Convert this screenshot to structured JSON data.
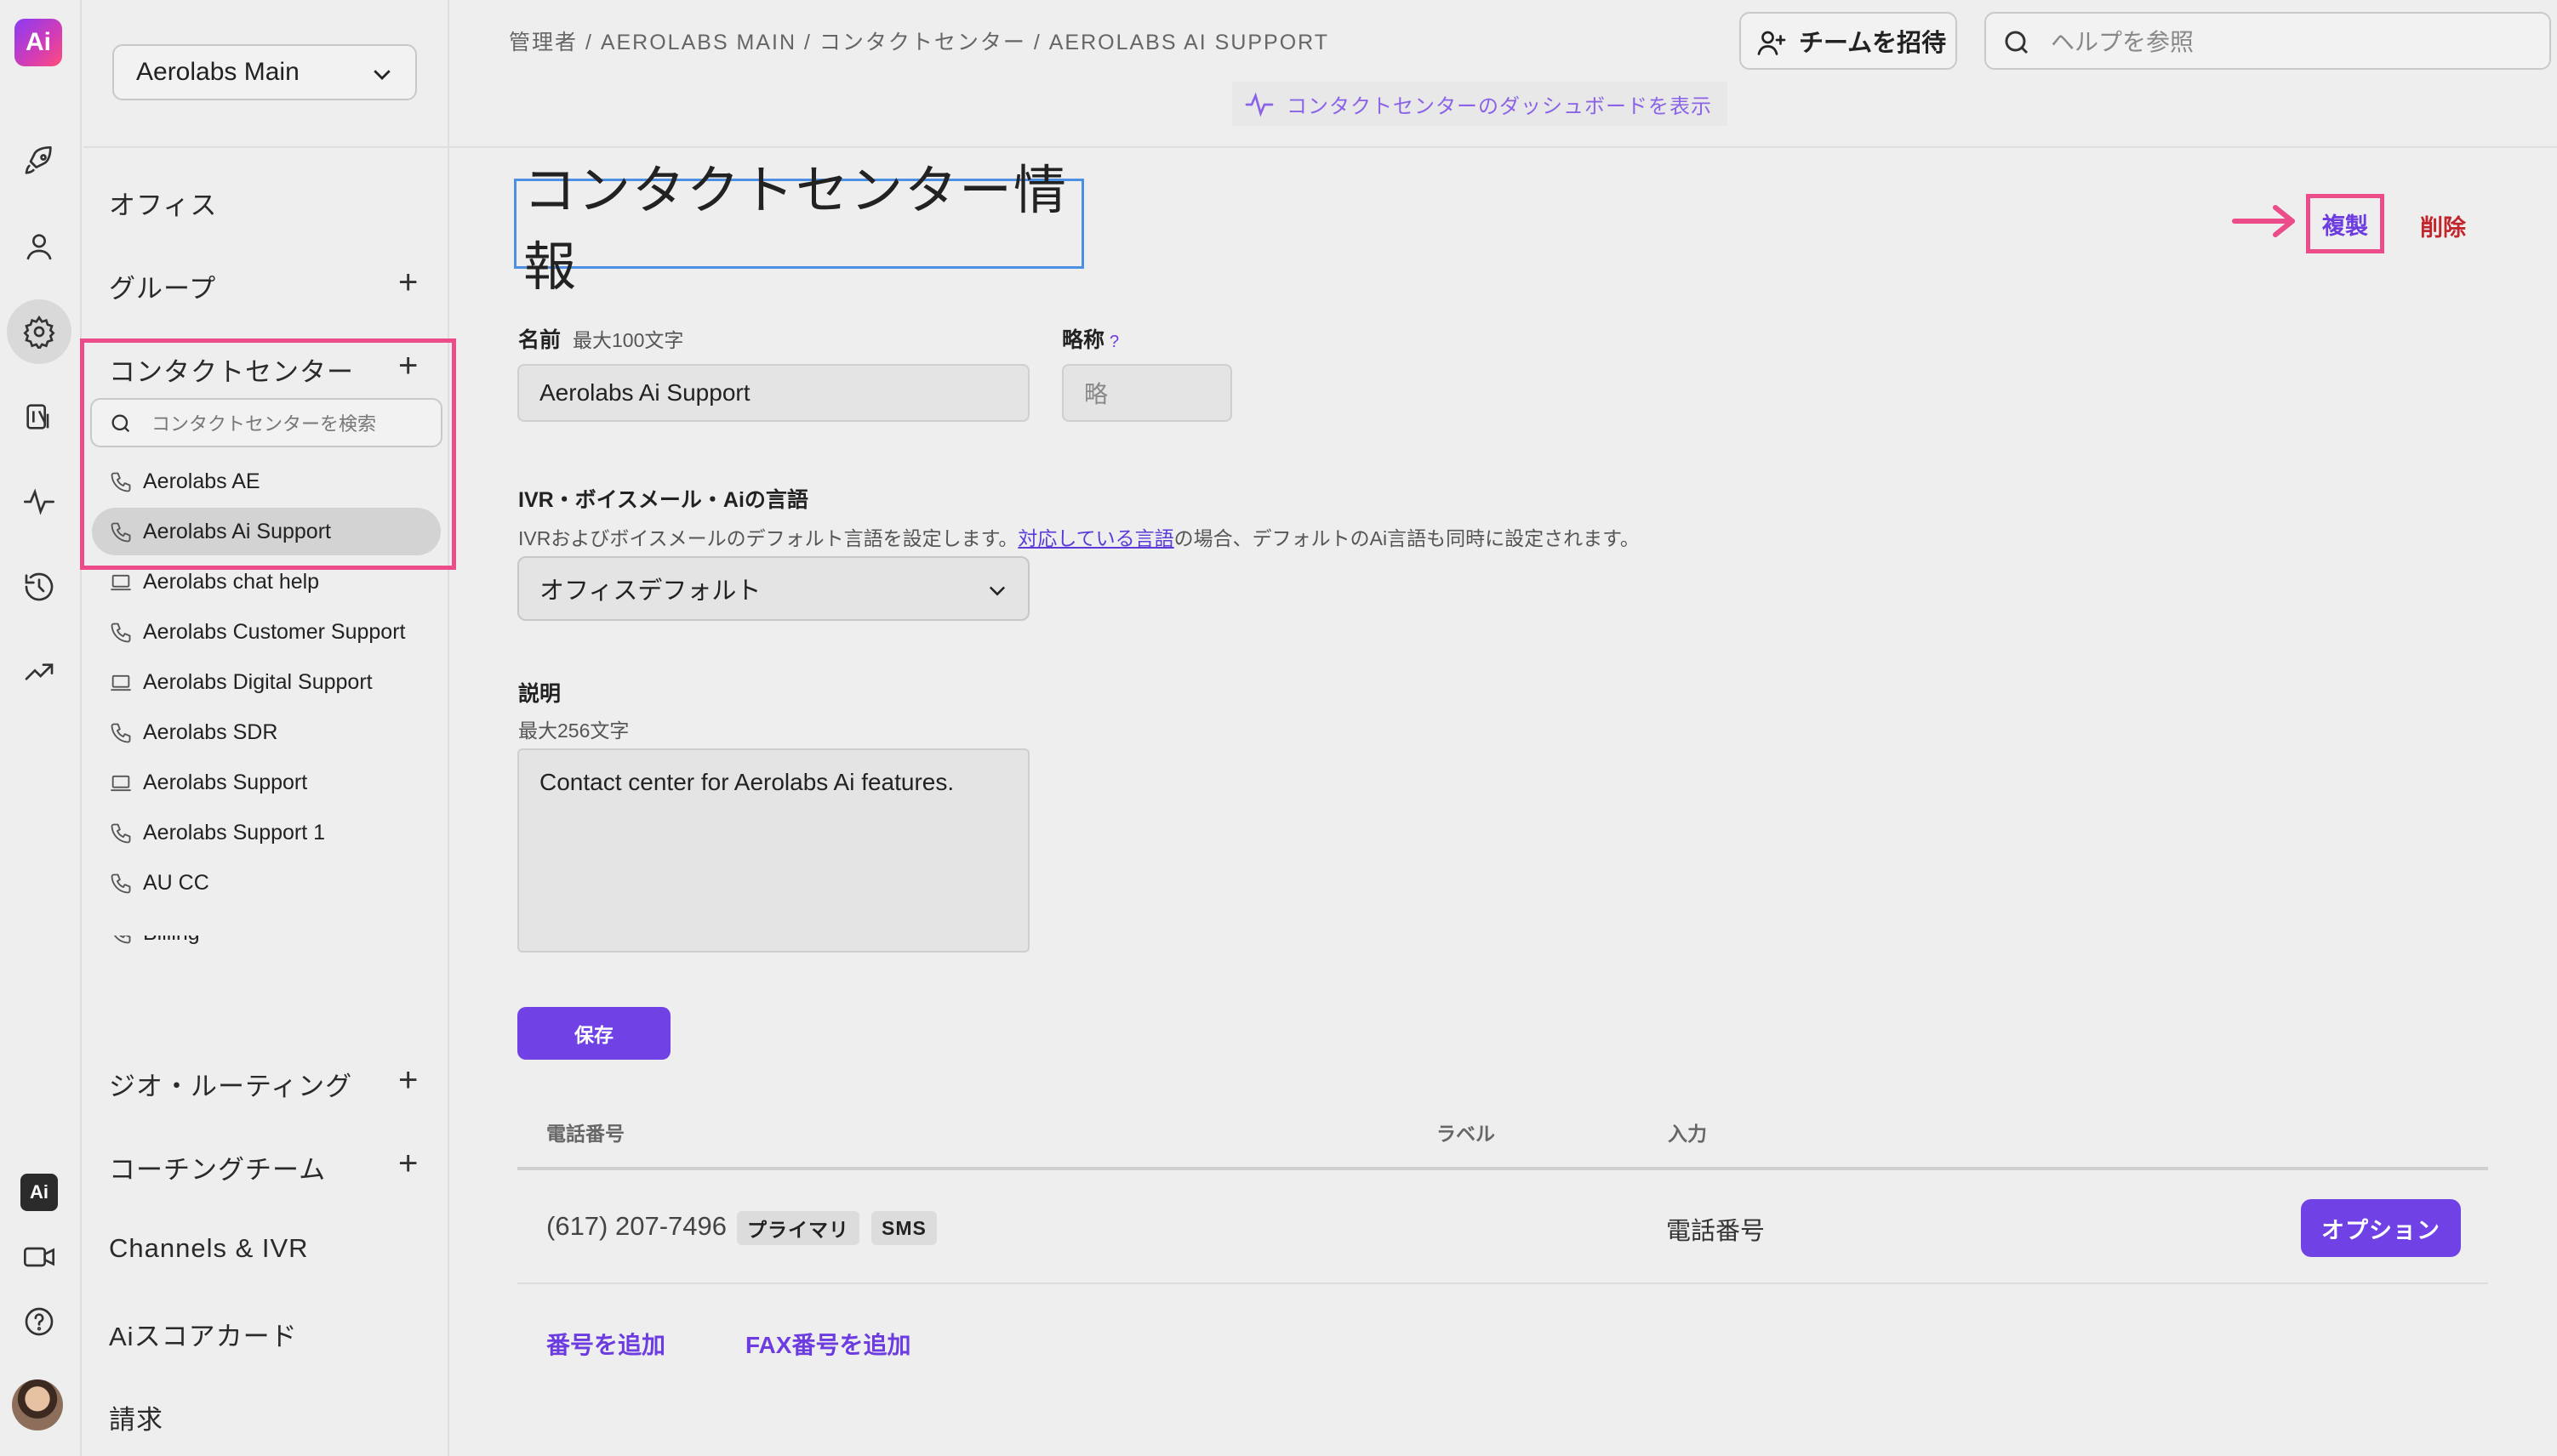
{
  "workspace": {
    "name": "Aerolabs Main"
  },
  "breadcrumb": "管理者 / AEROLABS MAIN / コンタクトセンター / AEROLABS AI SUPPORT",
  "header": {
    "invite_label": "チームを招待",
    "help_placeholder": "ヘルプを参照",
    "dashboard_link": "コンタクトセンターのダッシュボードを表示"
  },
  "sidebar": {
    "office": "オフィス",
    "groups": "グループ",
    "contact_center": "コンタクトセンター",
    "cc_search_placeholder": "コンタクトセンターを検索",
    "cc_items": [
      {
        "label": "Aerolabs AE",
        "icon": "phone-icon"
      },
      {
        "label": "Aerolabs Ai Support",
        "icon": "phone-icon"
      },
      {
        "label": "Aerolabs chat help",
        "icon": "laptop-icon"
      },
      {
        "label": "Aerolabs Customer Support",
        "icon": "phone-icon"
      },
      {
        "label": "Aerolabs Digital Support",
        "icon": "laptop-icon"
      },
      {
        "label": "Aerolabs SDR",
        "icon": "phone-icon"
      },
      {
        "label": "Aerolabs Support",
        "icon": "laptop-icon"
      },
      {
        "label": "Aerolabs Support 1",
        "icon": "phone-icon"
      },
      {
        "label": "AU CC",
        "icon": "phone-icon"
      },
      {
        "label": "Billing",
        "icon": "phone-icon"
      }
    ],
    "geo_routing": "ジオ・ルーティング",
    "coaching": "コーチングチーム",
    "channels": "Channels & IVR",
    "scorecard": "Aiスコアカード",
    "billing": "請求"
  },
  "main": {
    "title": "コンタクトセンター情報",
    "duplicate": "複製",
    "delete": "削除",
    "name_label": "名前",
    "name_hint": "最大100文字",
    "name_value": "Aerolabs Ai Support",
    "abbr_label": "略称",
    "abbr_help": "?",
    "abbr_placeholder": "略",
    "lang_label": "IVR・ボイスメール・Aiの言語",
    "lang_desc_pre": "IVRおよびボイスメールのデフォルト言語を設定します。",
    "lang_desc_link": "対応している言語",
    "lang_desc_post": "の場合、デフォルトのAi言語も同時に設定されます。",
    "lang_value": "オフィスデフォルト",
    "desc_label": "説明",
    "desc_hint": "最大256文字",
    "desc_value": "Contact center for Aerolabs Ai features.",
    "save": "保存"
  },
  "numbers_table": {
    "headers": {
      "number": "電話番号",
      "label": "ラベル",
      "input": "入力"
    },
    "rows": [
      {
        "number": "(617) 207-7496",
        "tags": [
          "プライマリ",
          "SMS"
        ],
        "input": "電話番号",
        "options": "オプション"
      }
    ],
    "add_number": "番号を追加",
    "add_fax": "FAX番号を追加"
  },
  "colors": {
    "accent": "#7042e6",
    "highlight": "#ec4c8a",
    "danger": "#c0262b"
  }
}
